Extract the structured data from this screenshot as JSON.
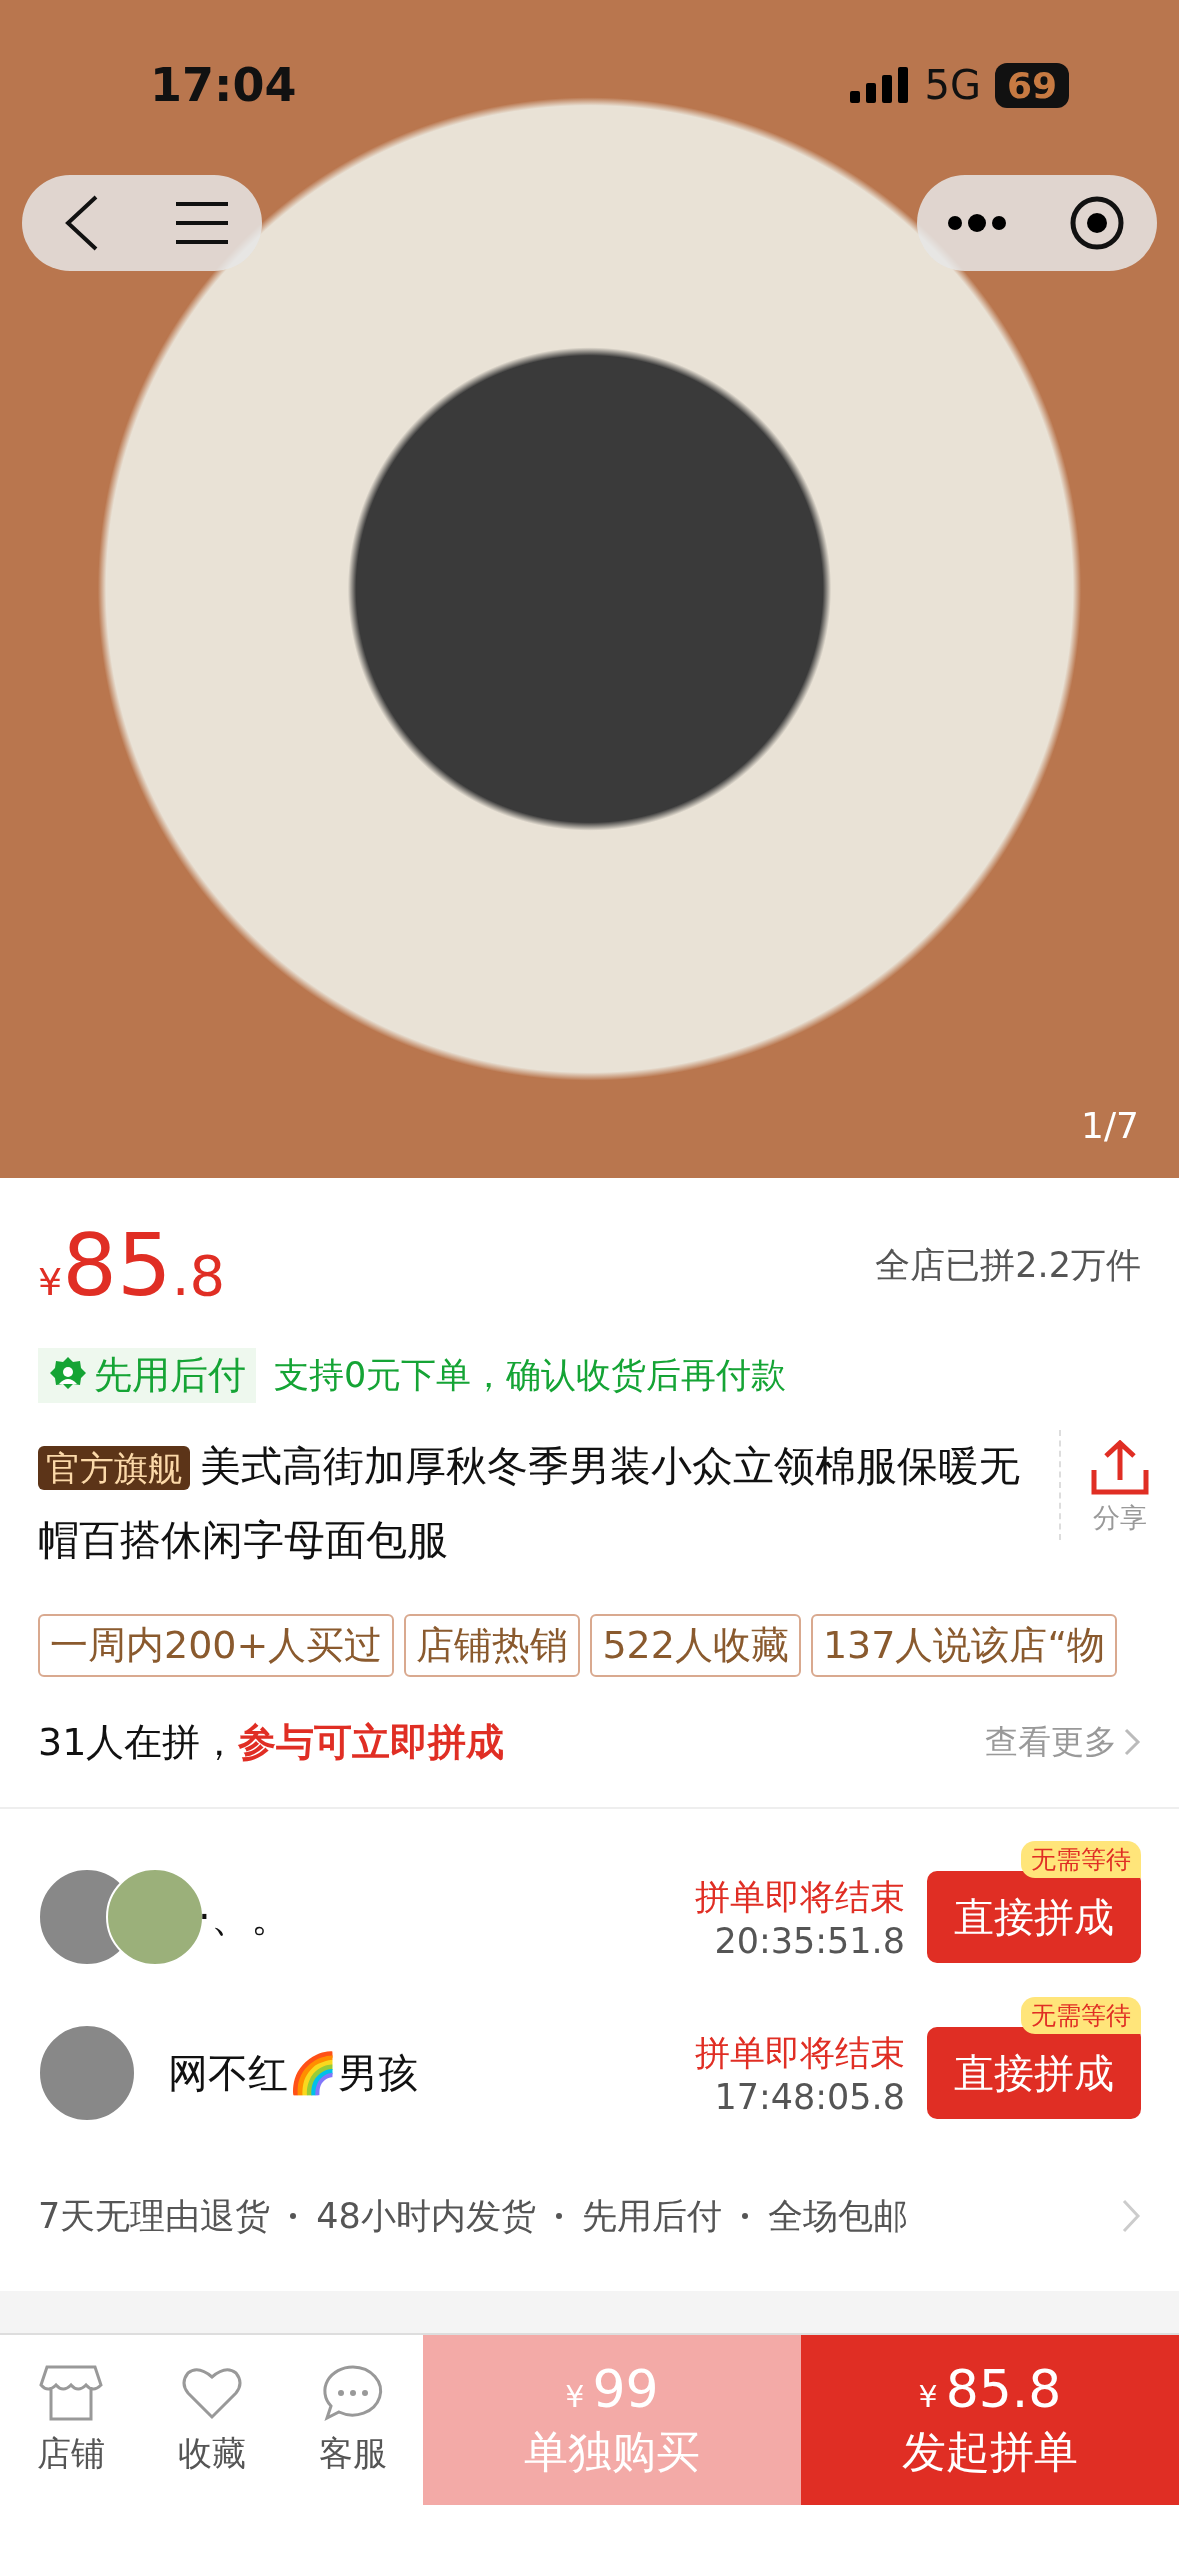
{
  "status_bar": {
    "time": "17:04",
    "network": "5G",
    "battery": "69"
  },
  "gallery": {
    "counter": "1/7"
  },
  "price": {
    "currency": "¥",
    "integer": "85",
    "decimal": ".8"
  },
  "sold": "全店已拼2.2万件",
  "pay_later": {
    "badge": "先用后付",
    "text": "支持0元下单，确认收货后再付款"
  },
  "title": {
    "badge": "官方旗舰",
    "text": "美式高街加厚秋冬季男装小众立领棉服保暖无帽百搭休闲字母面包服"
  },
  "share": {
    "label": "分享"
  },
  "tags": [
    "一周内200+人买过",
    "店铺热销",
    "522人收藏",
    "137人说该店“物"
  ],
  "group": {
    "count": "31人在拼，",
    "highlight": "参与可立即拼成",
    "more": "查看更多"
  },
  "groups": [
    {
      "kind": "double",
      "name": "·、。",
      "status": "拼单即将结束",
      "time": "20:35:51.8",
      "button": "直接拼成",
      "tag": "无需等待"
    },
    {
      "kind": "single",
      "name": "网不红🌈男孩",
      "status": "拼单即将结束",
      "time": "17:48:05.8",
      "button": "直接拼成",
      "tag": "无需等待"
    }
  ],
  "services": [
    "7天无理由退货",
    "48小时内发货",
    "先用后付",
    "全场包邮"
  ],
  "bottom_bar": {
    "icons": [
      {
        "kind": "store",
        "label": "店铺"
      },
      {
        "kind": "heart",
        "label": "收藏"
      },
      {
        "kind": "chat",
        "label": "客服"
      }
    ],
    "buy_alone": {
      "currency": "¥",
      "price": "99",
      "label": "单独购买"
    },
    "group_buy": {
      "currency": "¥",
      "price": "85.8",
      "label": "发起拼单"
    }
  }
}
